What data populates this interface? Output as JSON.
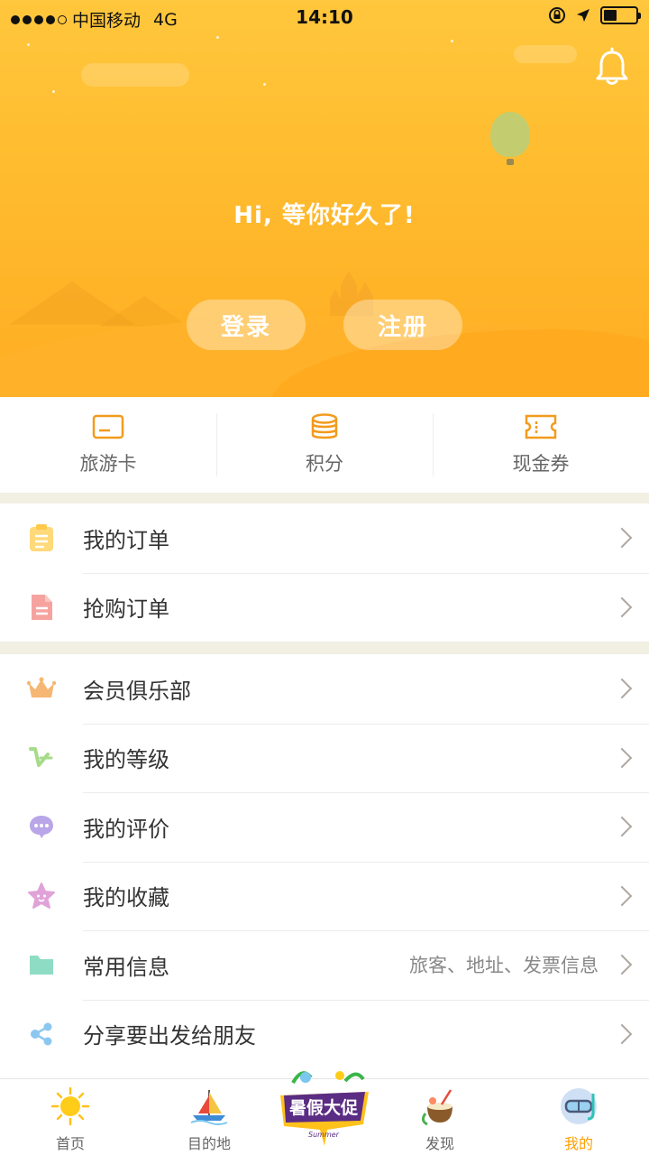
{
  "status_bar": {
    "carrier": "中国移动",
    "network": "4G",
    "time": "14:10"
  },
  "hero": {
    "greeting": "Hi, 等你好久了!",
    "login_label": "登录",
    "register_label": "注册",
    "bell_icon": "bell-icon"
  },
  "quick_links": [
    {
      "label": "旅游卡",
      "icon": "card-icon"
    },
    {
      "label": "积分",
      "icon": "coins-icon"
    },
    {
      "label": "现金券",
      "icon": "ticket-icon"
    }
  ],
  "menu_group_1": [
    {
      "label": "我的订单",
      "icon": "clipboard-icon",
      "color": "#ffd97a"
    },
    {
      "label": "抢购订单",
      "icon": "document-icon",
      "color": "#f6a3a0"
    }
  ],
  "menu_group_2": [
    {
      "label": "会员俱乐部",
      "icon": "crown-icon",
      "color": "#f5b773"
    },
    {
      "label": "我的等级",
      "icon": "level-icon",
      "color": "#a6db8a"
    },
    {
      "label": "我的评价",
      "icon": "comment-icon",
      "color": "#b9a6e8"
    },
    {
      "label": "我的收藏",
      "icon": "star-icon",
      "color": "#e0a3d8"
    },
    {
      "label": "常用信息",
      "value": "旅客、地址、发票信息",
      "icon": "folder-icon",
      "color": "#8fdcc4"
    },
    {
      "label": "分享要出发给朋友",
      "icon": "share-icon",
      "color": "#8cc7f0"
    }
  ],
  "tab_bar": {
    "tabs": [
      {
        "label": "首页",
        "icon": "sun-icon"
      },
      {
        "label": "目的地",
        "icon": "sailboat-icon"
      },
      {
        "label": "发现",
        "icon": "coconut-drink-icon"
      },
      {
        "label": "我的",
        "icon": "snorkel-mask-icon",
        "active": true
      }
    ],
    "promo": {
      "title": "暑假大促",
      "subtitle": "Summer"
    }
  },
  "colors": {
    "accent": "#ffb22a",
    "active_tab": "#ff9f00",
    "divider": "#f2efe3"
  }
}
